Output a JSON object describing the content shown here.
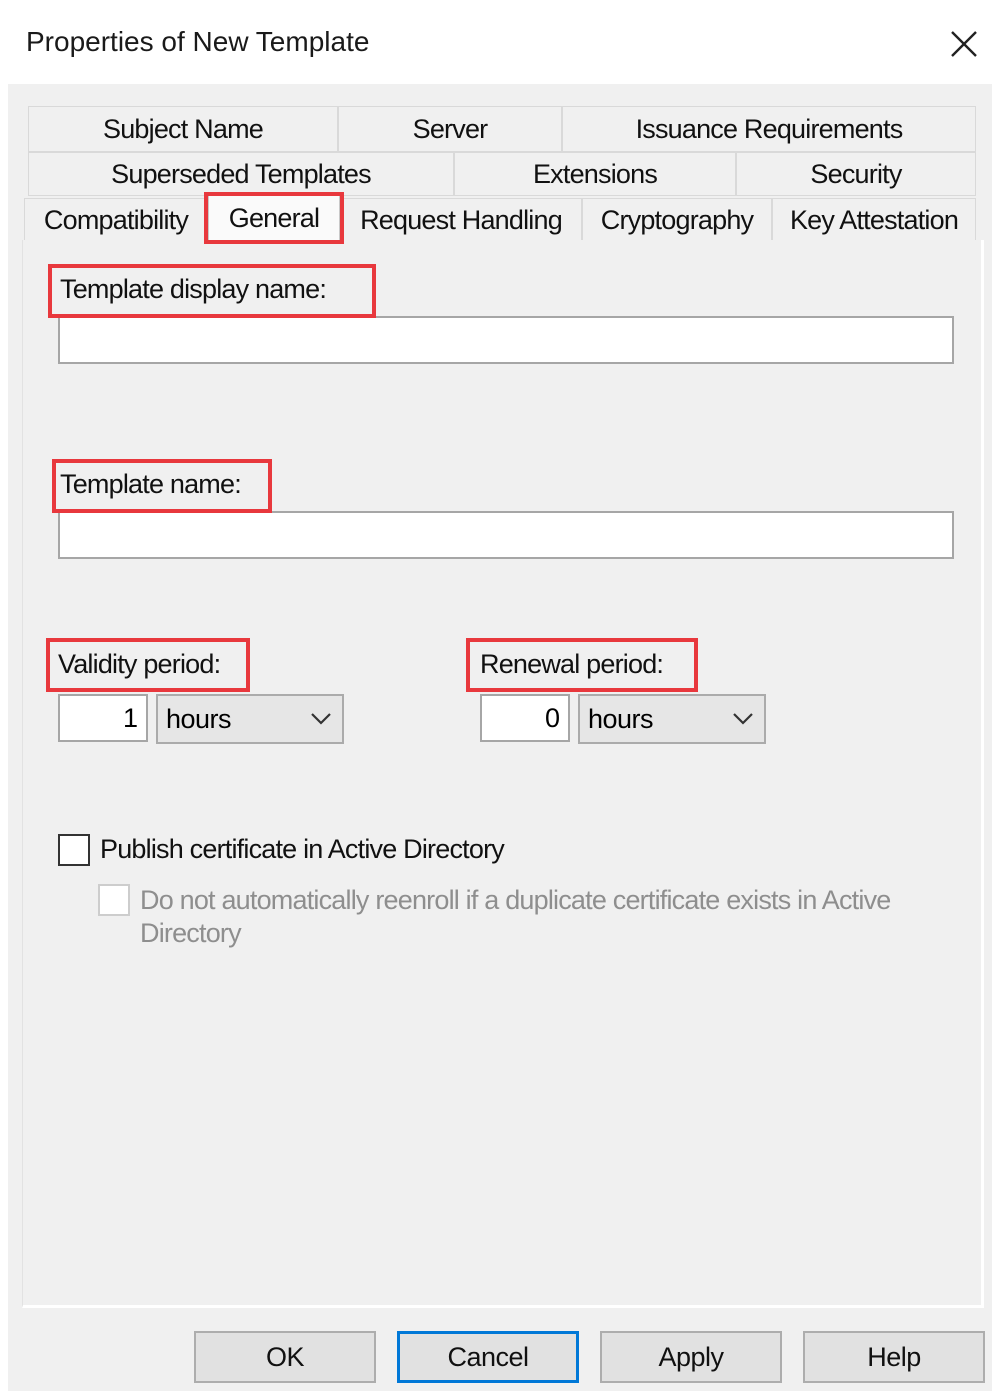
{
  "window": {
    "title": "Properties of New Template",
    "close_icon": "close-icon"
  },
  "tabs": {
    "row1": [
      "Subject Name",
      "Server",
      "Issuance Requirements"
    ],
    "row2": [
      "Superseded Templates",
      "Extensions",
      "Security"
    ],
    "row3": [
      "Compatibility",
      "General",
      "Request Handling",
      "Cryptography",
      "Key Attestation"
    ],
    "selected": "General"
  },
  "general": {
    "display_name_label": "Template display name:",
    "display_name_value": "",
    "template_name_label": "Template name:",
    "template_name_value": "",
    "validity": {
      "label": "Validity period:",
      "value": "1",
      "unit": "hours"
    },
    "renewal": {
      "label": "Renewal period:",
      "value": "0",
      "unit": "hours"
    },
    "publish_checkbox": {
      "label": "Publish certificate in Active Directory",
      "checked": false
    },
    "reenroll_checkbox": {
      "label": "Do not automatically reenroll if a duplicate certificate exists in Active Directory",
      "checked": false,
      "enabled": false
    }
  },
  "buttons": {
    "ok": "OK",
    "cancel": "Cancel",
    "apply": "Apply",
    "help": "Help"
  },
  "colors": {
    "highlight": "#e8383d",
    "default_button_border": "#0078d7",
    "dialog_bg": "#f0f0f0"
  }
}
